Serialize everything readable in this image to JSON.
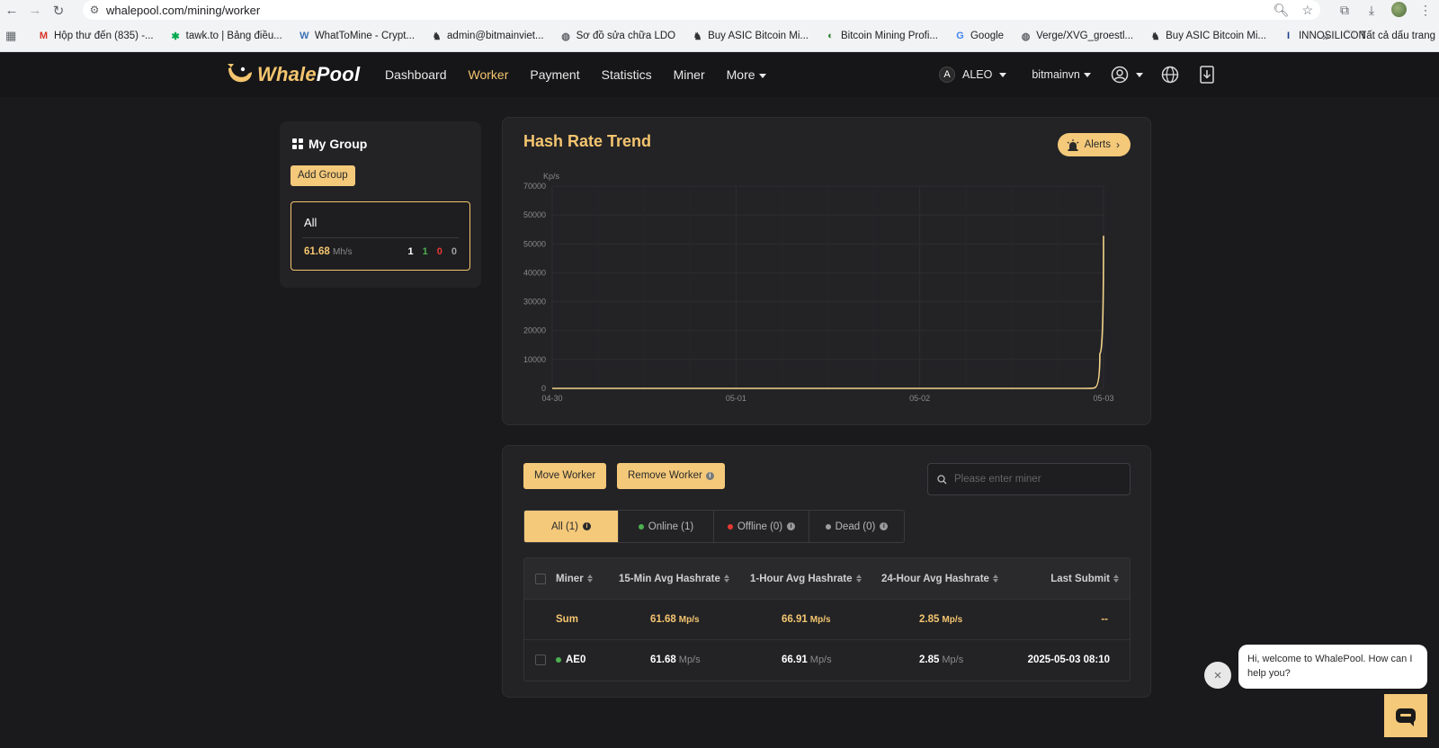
{
  "browser": {
    "url": "whalepool.com/mining/worker",
    "bookmarks": [
      {
        "label": "Hộp thư đến (835) -...",
        "icon": "gmail-icon"
      },
      {
        "label": "tawk.to | Bảng điều...",
        "icon": "tawk-icon"
      },
      {
        "label": "WhatToMine - Crypt...",
        "icon": "whattomine-icon"
      },
      {
        "label": "admin@bitmainviet...",
        "icon": "bitmain-icon"
      },
      {
        "label": "Sơ đồ sửa chữa LDO",
        "icon": "globe-icon"
      },
      {
        "label": "Buy ASIC Bitcoin Mi...",
        "icon": "bitmain-icon"
      },
      {
        "label": "Bitcoin Mining Profi...",
        "icon": "bitcoin-icon"
      },
      {
        "label": "Google",
        "icon": "google-icon"
      },
      {
        "label": "Verge/XVG_groestl...",
        "icon": "globe-icon"
      },
      {
        "label": "Buy ASIC Bitcoin Mi...",
        "icon": "bitmain-icon"
      },
      {
        "label": "INNOSILICON",
        "icon": "innosilicon-icon"
      }
    ],
    "bookmarks_more": "»",
    "all_bookmarks": "Tất cả dấu trang"
  },
  "header": {
    "logo_text_a": "Whale",
    "logo_text_b": "Pool",
    "nav": [
      {
        "label": "Dashboard",
        "active": false
      },
      {
        "label": "Worker",
        "active": true
      },
      {
        "label": "Payment",
        "active": false
      },
      {
        "label": "Statistics",
        "active": false
      },
      {
        "label": "Miner",
        "active": false
      },
      {
        "label": "More",
        "active": false
      }
    ],
    "coin_badge": "A",
    "coin": "ALEO",
    "account": "bitmainvn"
  },
  "group": {
    "title": "My Group",
    "add_label": "Add Group",
    "card": {
      "name": "All",
      "hashrate": "61.68",
      "unit": "Mh/s",
      "counts": [
        {
          "value": "1",
          "color": "#ffffff"
        },
        {
          "value": "1",
          "color": "#4caf50"
        },
        {
          "value": "0",
          "color": "#e53935"
        },
        {
          "value": "0",
          "color": "#9e9e9e"
        }
      ]
    }
  },
  "chart": {
    "title": "Hash Rate Trend",
    "alerts_label": "Alerts"
  },
  "chart_data": {
    "type": "line",
    "ylabel": "Kp/s",
    "y_ticks": [
      "70000",
      "50000",
      "50000",
      "40000",
      "30000",
      "20000",
      "10000",
      "0"
    ],
    "y_tick_values": [
      70000,
      60000,
      50000,
      40000,
      30000,
      20000,
      10000,
      0
    ],
    "x_ticks": [
      "04-30",
      "05-01",
      "05-02",
      "05-03"
    ],
    "ylim": [
      0,
      70000
    ],
    "x_range_days": [
      0,
      3
    ],
    "series": [
      {
        "color": "#f4d38a",
        "x": [
          0,
          1,
          2,
          2.9,
          2.95,
          2.98,
          3.0
        ],
        "y": [
          0,
          0,
          0,
          0,
          200,
          12000,
          52800
        ]
      }
    ],
    "grid": true
  },
  "workers": {
    "move_label": "Move Worker",
    "remove_label": "Remove Worker",
    "search_placeholder": "Please enter miner",
    "tabs": [
      {
        "label": "All (1)",
        "active": true,
        "dot": ""
      },
      {
        "label": "Online (1)",
        "active": false,
        "dot": "#4caf50"
      },
      {
        "label": "Offline (0)",
        "active": false,
        "dot": "#e53935"
      },
      {
        "label": "Dead (0)",
        "active": false,
        "dot": "#9e9e9e"
      }
    ],
    "columns": [
      "Miner",
      "15-Min Avg Hashrate",
      "1-Hour Avg Hashrate",
      "24-Hour Avg Hashrate",
      "Last Submit"
    ],
    "sum": {
      "name": "Sum",
      "h15": "61.68",
      "h1": "66.91",
      "h24": "2.85",
      "unit": "Mp/s",
      "last": "--"
    },
    "rows": [
      {
        "name": "AE0",
        "status_color": "#4caf50",
        "h15": "61.68",
        "h1": "66.91",
        "h24": "2.85",
        "unit": "Mp/s",
        "last": "2025-05-03 08:10"
      }
    ]
  },
  "chat": {
    "close": "×",
    "message": "Hi, welcome to WhalePool. How can I help you?"
  }
}
